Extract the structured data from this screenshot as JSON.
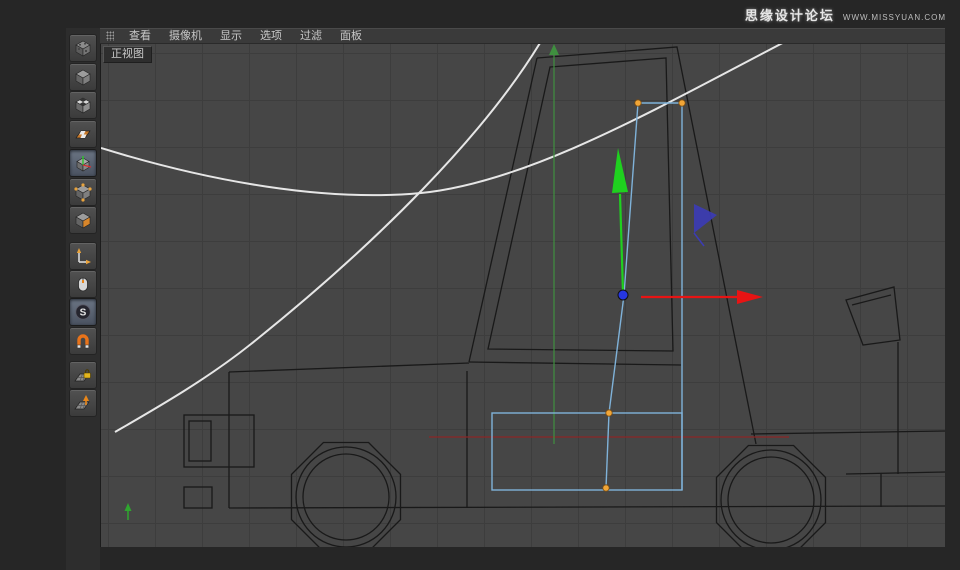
{
  "chrome": {
    "watermark_title": "思缘设计论坛",
    "watermark_url": "WWW.MISSYUAN.COM"
  },
  "menu": {
    "items": [
      "查看",
      "摄像机",
      "显示",
      "选项",
      "过滤",
      "面板"
    ]
  },
  "viewport": {
    "label": "正视图"
  },
  "toolbar": {
    "items": [
      {
        "name": "make-editable",
        "icon": "textured-cube-icon",
        "active": false
      },
      {
        "name": "model-mode",
        "icon": "cube-icon",
        "active": false
      },
      {
        "name": "texture-mode",
        "icon": "checker-cube-icon",
        "active": false
      },
      {
        "name": "workplane-mode",
        "icon": "checker-plane-icon",
        "active": false
      },
      {
        "name": "object-mode",
        "icon": "cube-axes-icon",
        "active": true
      },
      {
        "name": "points-mode",
        "icon": "cube-points-icon",
        "active": false
      },
      {
        "name": "polygons-mode",
        "icon": "cube-face-icon",
        "active": false
      },
      {
        "name": "enable-axis",
        "icon": "axis-icon",
        "active": false
      },
      {
        "name": "viewport-solo",
        "icon": "mouse-icon",
        "active": false
      },
      {
        "name": "enable-snap",
        "icon": "snap-sphere-icon",
        "active": true
      },
      {
        "name": "magnet-snap",
        "icon": "magnet-icon",
        "active": false
      },
      {
        "name": "lock-workplane",
        "icon": "grid-lock-icon",
        "active": false
      },
      {
        "name": "align-workplane",
        "icon": "grid-arrow-icon",
        "active": false
      }
    ]
  },
  "colors": {
    "viewport_bg": "#464646",
    "grid_line": "#3d3d3d",
    "wireframe": "#191919",
    "guide_spline": "#e6e6e6",
    "world_axis_x": "#8b2727",
    "world_axis_y": "#3f8f3f",
    "gizmo_x": "#e81414",
    "gizmo_y": "#1fd11f",
    "gizmo_z": "#3c3cb4",
    "gizmo_center": "#2636e0",
    "selection": "#7fb2d9",
    "vertex_point": "#f0a537"
  }
}
